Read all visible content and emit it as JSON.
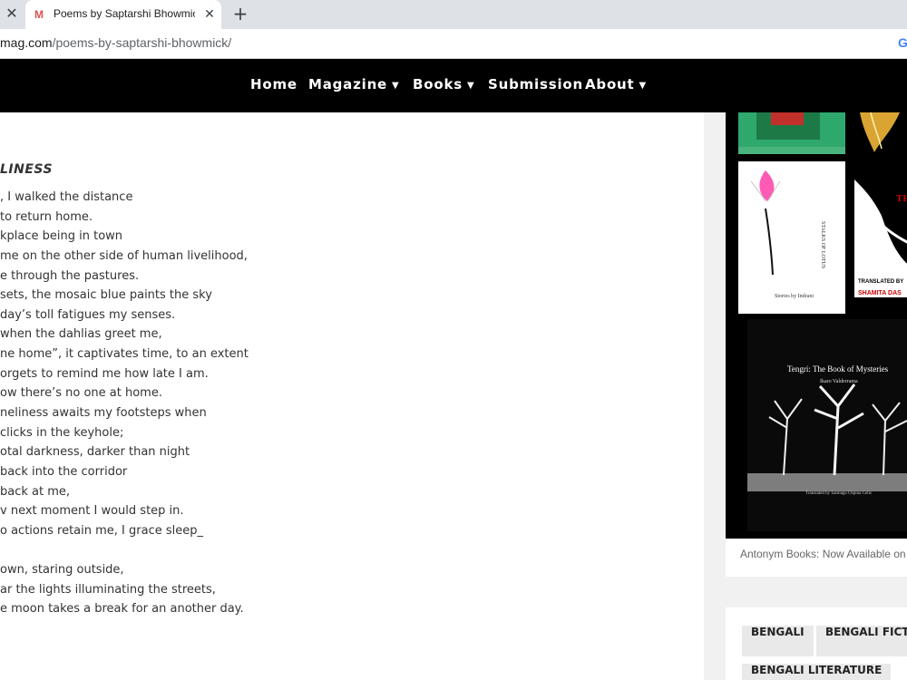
{
  "browser": {
    "tab_title": "Poems by Saptarshi Bhowmick -",
    "favicon_letter": "M",
    "url_domain": "mag.com",
    "url_path": "/poems-by-saptarshi-bhowmick/",
    "icons": [
      "close-icon",
      "plus-icon",
      "google-icon"
    ]
  },
  "nav": {
    "items": [
      {
        "label": "Home"
      },
      {
        "label": "Magazine",
        "dropdown": true
      },
      {
        "label": "Books",
        "dropdown": true
      },
      {
        "label": "Submission"
      },
      {
        "label": "About",
        "dropdown": true
      }
    ]
  },
  "poem": {
    "title": "LINESS",
    "lines": [
      ", I walked the distance",
      "to return home.",
      "kplace being in town",
      "me on the other side of human livelihood,",
      "e through the pastures.",
      "sets, the mosaic blue paints the sky",
      " day’s toll fatigues my senses.",
      "when the dahlias greet me,",
      "ne home”, it captivates time, to an extent",
      "orgets to remind me how late I am.",
      "ow there’s no one at home.",
      "neliness awaits my footsteps when",
      "clicks in the keyhole;",
      "otal darkness, darker than night",
      "back into the corridor",
      " back at me,",
      "v next moment I would step in.",
      "o actions retain me, I grace sleep_",
      "",
      "own, staring outside,",
      "ar the lights illuminating the streets,",
      "e moon takes a break for an another day."
    ]
  },
  "sidebar": {
    "books": {
      "lotus_cover_text": "Stories by Indrani",
      "lotus_vertical": "STALKS OF LOTUS",
      "tr_cover_line1": "TRANSLATED BY",
      "tr_cover_line2": "SHAMITA DAS",
      "tr_cover_letters": "TH",
      "tengri_title": "Tengri: The Book of Mysteries",
      "tengri_author": "Ikaro Valderrama",
      "tengri_translator": "Translated by Santiago Ospina Celis",
      "caption": "Antonym Books: Now Available on"
    },
    "tags": [
      "BENGALI",
      "BENGALI FICTI",
      "BENGALI LITERATURE"
    ]
  },
  "colors": {
    "nav_bg": "#000000",
    "sidebar_bg": "#f1f1f1",
    "tag_bg": "#e9e9e9"
  }
}
